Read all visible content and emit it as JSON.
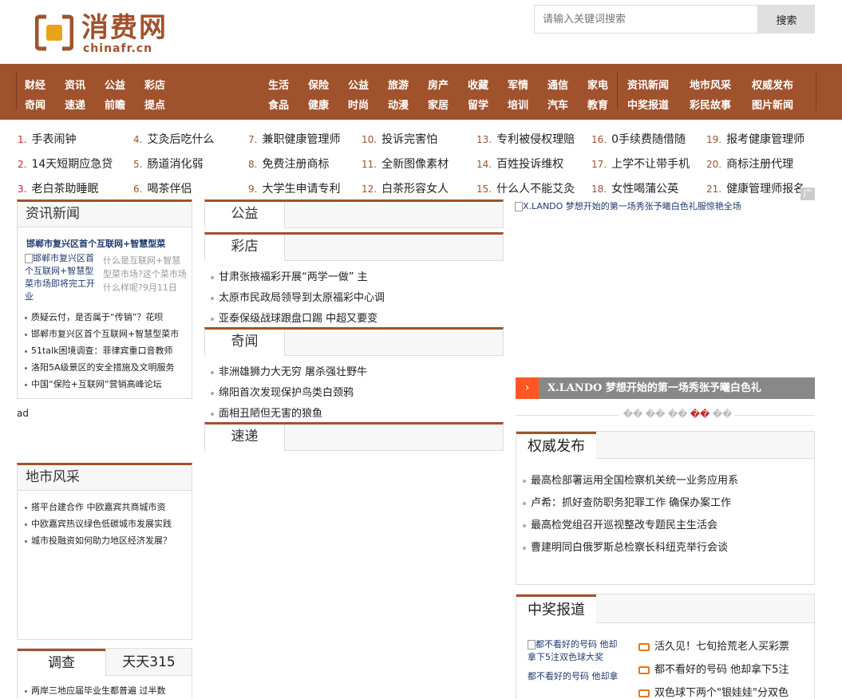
{
  "header": {
    "logo_cn": "消费网",
    "logo_en": "chinafr.cn",
    "search_placeholder": "请输入关键词搜索",
    "search_button": "搜索"
  },
  "nav": {
    "groupA_row1": [
      "财经",
      "资讯",
      "公益",
      "彩店"
    ],
    "groupA_row2": [
      "奇闻",
      "速递",
      "前瞻",
      "提点"
    ],
    "groupB_row1": [
      "生活",
      "保险",
      "公益",
      "旅游",
      "房产",
      "收藏",
      "军情",
      "通信",
      "家电"
    ],
    "groupB_row2": [
      "食品",
      "健康",
      "时尚",
      "动漫",
      "家居",
      "留学",
      "培训",
      "汽车",
      "教育"
    ],
    "groupC_row1": [
      "资讯新闻",
      "地市风采",
      "权威发布"
    ],
    "groupC_row2": [
      "中奖报道",
      "彩民故事",
      "图片新闻"
    ]
  },
  "hot": [
    {
      "n": "1.",
      "t": "手表闹钟"
    },
    {
      "n": "2.",
      "t": "14天短期应急贷"
    },
    {
      "n": "3.",
      "t": "老白茶助睡眠"
    },
    {
      "n": "4.",
      "t": "艾灸后吃什么"
    },
    {
      "n": "5.",
      "t": "肠道消化弱"
    },
    {
      "n": "6.",
      "t": "喝茶伴侣"
    },
    {
      "n": "7.",
      "t": "兼职健康管理师"
    },
    {
      "n": "8.",
      "t": "免费注册商标"
    },
    {
      "n": "9.",
      "t": "大学生申请专利"
    },
    {
      "n": "10.",
      "t": "投诉完害怕"
    },
    {
      "n": "11.",
      "t": "全新图像素材"
    },
    {
      "n": "12.",
      "t": "白茶形容女人"
    },
    {
      "n": "13.",
      "t": "专利被侵权理赔"
    },
    {
      "n": "14.",
      "t": "百姓投诉维权"
    },
    {
      "n": "15.",
      "t": "什么人不能艾灸"
    },
    {
      "n": "16.",
      "t": "0手续费随借随"
    },
    {
      "n": "17.",
      "t": "上学不让带手机"
    },
    {
      "n": "18.",
      "t": "女性喝蒲公英"
    },
    {
      "n": "19.",
      "t": "报考健康管理师"
    },
    {
      "n": "20.",
      "t": "商标注册代理"
    },
    {
      "n": "21.",
      "t": "健康管理师报名"
    }
  ],
  "ad_tag": "广告",
  "left": {
    "news_title": "资讯新闻",
    "feature_title": "邯郸市复兴区首个互联网+智慧型菜",
    "feature_img_alt": "邯郸市复兴区首个互联网+智慧型菜市场即将完工开业",
    "feature_text": "什么是互联网+智慧型菜市场?这个菜市场什么样呢?9月11日",
    "news_links": [
      "质疑云付，是否属于“传销”？花呗",
      "邯郸市复兴区首个互联网+智慧型菜市",
      "51talk困境调查：菲律宾重口音教师",
      "洛阳5A级景区的安全措施及文明服务",
      "中国“保险+互联网”营销高峰论坛"
    ],
    "ad_text": "ad",
    "city_title": "地市风采",
    "city_links": [
      "搭平台建合作 中欧嘉宾共商城市资",
      "中欧嘉宾热议绿色低碳城市发展实践",
      "城市投融资如何助力地区经济发展？"
    ],
    "tab1": "调查",
    "tab2": "天天315",
    "survey_link": "两岸三地应届毕业生都普遍 过半数"
  },
  "mid": {
    "gongyi": "公益",
    "caidian": "彩店",
    "caidian_links": [
      "甘肃张掖福彩开展“两学一做” 主",
      "太原市民政局领导到太原福彩中心调",
      "亚泰保级战球跟盘口踢 中超又要变"
    ],
    "qiwen": "奇闻",
    "qiwen_links": [
      "非洲雄狮力大无穷 屠杀强壮野牛",
      "绵阳首次发现保护鸟类白颈鸦",
      "面相丑陋但无害的狼鱼"
    ],
    "sudi": "速递"
  },
  "right": {
    "slide_img_alt": "X.LANDO 梦想开始的第一场秀张予曦白色礼服惊艳全场",
    "slide_caption": "X.LANDO 梦想开始的第一场秀张予曦白色礼",
    "slide_dots": [
      "��",
      "��",
      "��",
      "��",
      "��"
    ],
    "quanwei_title": "权威发布",
    "quanwei_links": [
      "最高检部署运用全国检察机关统一业务应用系",
      "卢希：抓好查防职务犯罪工作 确保办案工作",
      "最高检党组召开巡视整改专题民主生活会",
      "曹建明同白俄罗斯总检察长科纽克举行会谈"
    ],
    "zhongjiang_title": "中奖报道",
    "zj_img_alt": "都不看好的号码 他却拿下5注双色球大奖",
    "zj_img_text": "都不看好的号码 他却拿",
    "zj_links": [
      "活久见！七旬拾荒老人买彩票",
      "都不看好的号码 他却拿下5注",
      "双色球下两个\"银娃娃\"分双色"
    ],
    "accent": "#a0522d",
    "caption_bg": "#888888",
    "arrow_color": "#ff5722"
  }
}
